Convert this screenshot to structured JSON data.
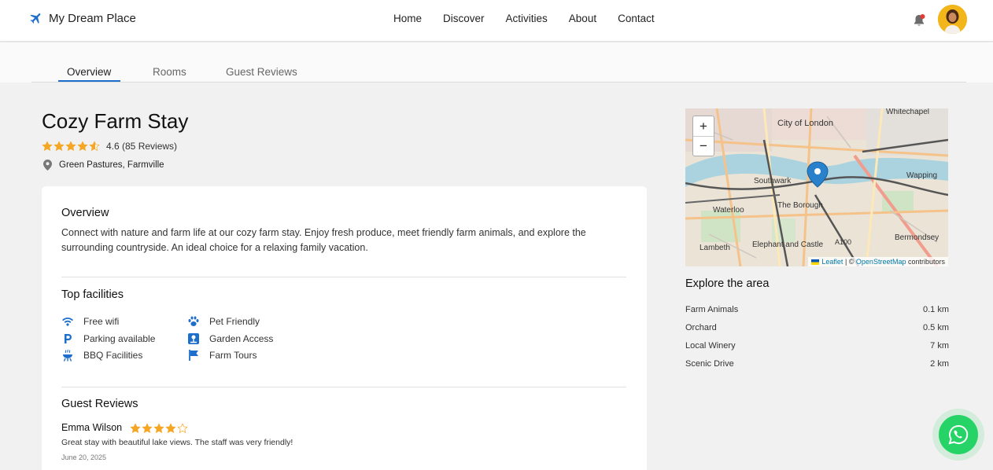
{
  "app": {
    "name": "My Dream Place"
  },
  "nav": [
    "Home",
    "Discover",
    "Activities",
    "About",
    "Contact"
  ],
  "tabs": [
    "Overview",
    "Rooms",
    "Guest Reviews"
  ],
  "property": {
    "title": "Cozy Farm Stay",
    "rating_text": "4.6 (85 Reviews)",
    "rating": 4.6,
    "location": "Green Pastures, Farmville"
  },
  "overview": {
    "heading": "Overview",
    "description": "Connect with nature and farm life at our cozy farm stay. Enjoy fresh produce, meet friendly farm animals, and explore the surrounding countryside. An ideal choice for a relaxing family vacation."
  },
  "facilities": {
    "heading": "Top facilities",
    "items": [
      {
        "label": "Free wifi",
        "icon": "wifi-icon"
      },
      {
        "label": "Parking available",
        "icon": "parking-icon"
      },
      {
        "label": "BBQ Facilities",
        "icon": "bbq-icon"
      },
      {
        "label": "Pet Friendly",
        "icon": "paw-icon"
      },
      {
        "label": "Garden Access",
        "icon": "garden-icon"
      },
      {
        "label": "Farm Tours",
        "icon": "flag-icon"
      }
    ]
  },
  "reviews": {
    "heading": "Guest Reviews",
    "items": [
      {
        "name": "Emma Wilson",
        "stars": 4,
        "text": "Great stay with beautiful lake views. The staff was very friendly!",
        "date": "June 20, 2025"
      }
    ]
  },
  "map": {
    "zoom_in": "+",
    "zoom_out": "−",
    "attribution_leaflet": "Leaflet",
    "attribution_sep": " | © ",
    "attribution_osm": "OpenStreetMap",
    "attribution_tail": " contributors",
    "labels": [
      "Whitechapel",
      "City of London",
      "Southwark",
      "Wapping",
      "Waterloo",
      "The Borough",
      "A100",
      "Bermondsey",
      "Lambeth",
      "Elephant and Castle"
    ]
  },
  "explore": {
    "heading": "Explore the area",
    "items": [
      {
        "name": "Farm Animals",
        "distance": "0.1 km"
      },
      {
        "name": "Orchard",
        "distance": "0.5 km"
      },
      {
        "name": "Local Winery",
        "distance": "7 km"
      },
      {
        "name": "Scenic Drive",
        "distance": "2 km"
      }
    ]
  },
  "colors": {
    "accent": "#1e6fcc",
    "star": "#f5a623",
    "whatsapp": "#25d366",
    "bell_dot": "#e53935"
  }
}
